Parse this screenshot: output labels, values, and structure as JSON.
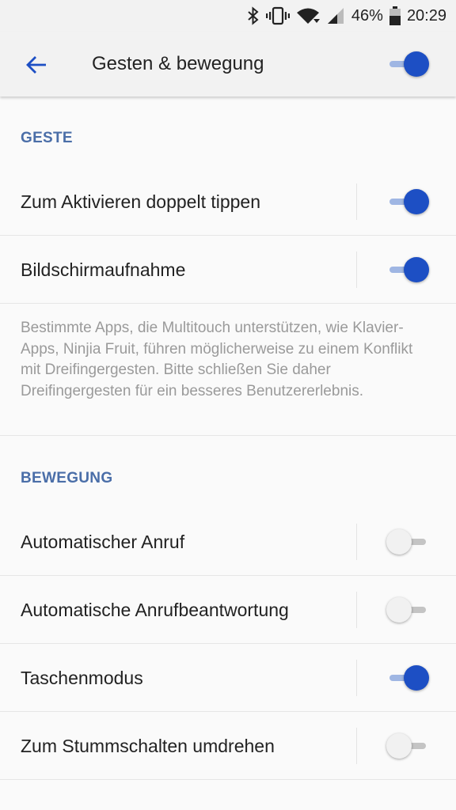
{
  "status_bar": {
    "battery_percent": "46%",
    "time": "20:29",
    "icons": [
      "bluetooth-icon",
      "vibrate-icon",
      "wifi-icon",
      "signal-icon",
      "battery-icon"
    ]
  },
  "app_bar": {
    "title": "Gesten & bewegung",
    "back_icon": "arrow-left-icon",
    "master_toggle_on": true
  },
  "sections": {
    "geste": {
      "header": "GESTE",
      "items": [
        {
          "label": "Zum Aktivieren doppelt tippen",
          "on": true
        },
        {
          "label": "Bildschirmaufnahme",
          "on": true
        }
      ],
      "note": "Bestimmte Apps, die Multitouch unterstützen, wie Klavier-Apps, Ninjia Fruit, führen möglicherweise zu einem Konflikt mit Dreifingergesten. Bitte schließen Sie daher Dreifingergesten für ein besseres Benutzererlebnis."
    },
    "bewegung": {
      "header": "BEWEGUNG",
      "items": [
        {
          "label": "Automatischer Anruf",
          "on": false
        },
        {
          "label": "Automatische Anrufbeantwortung",
          "on": false
        },
        {
          "label": "Taschenmodus",
          "on": true
        },
        {
          "label": "Zum Stummschalten umdrehen",
          "on": false
        }
      ]
    }
  },
  "colors": {
    "accent": "#1d4fc4",
    "accent_track": "#9fb6e3",
    "section_header": "#4a6ea8",
    "note_text": "#9a9a9a"
  }
}
